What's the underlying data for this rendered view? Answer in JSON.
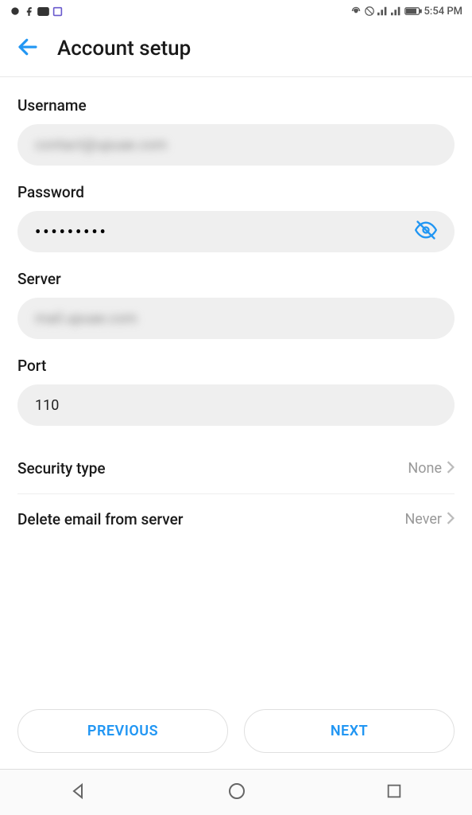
{
  "statusBar": {
    "time": "5:54 PM"
  },
  "header": {
    "title": "Account setup"
  },
  "fields": {
    "username": {
      "label": "Username",
      "value": "contact@upuae.com"
    },
    "password": {
      "label": "Password",
      "value": "•••••••••"
    },
    "server": {
      "label": "Server",
      "value": "mail.upuae.com"
    },
    "port": {
      "label": "Port",
      "value": "110"
    }
  },
  "settings": {
    "securityType": {
      "label": "Security type",
      "value": "None"
    },
    "deleteEmail": {
      "label": "Delete email from server",
      "value": "Never"
    }
  },
  "buttons": {
    "previous": "PREVIOUS",
    "next": "NEXT"
  }
}
